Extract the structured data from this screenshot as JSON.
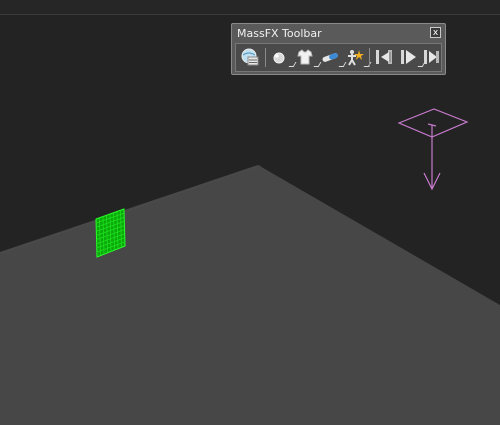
{
  "toolbar": {
    "title": "MassFX Toolbar",
    "close_glyph": "x",
    "buttons": [
      {
        "id": "world-params",
        "icon": "massfx-world-parameters-icon"
      },
      {
        "id": "rigid-body",
        "icon": "rigid-body-icon"
      },
      {
        "id": "mcloth",
        "icon": "mcloth-icon"
      },
      {
        "id": "constraint",
        "icon": "constraint-icon"
      },
      {
        "id": "ragdoll",
        "icon": "ragdoll-icon"
      },
      {
        "id": "reset-sim",
        "icon": "reset-simulation-icon"
      },
      {
        "id": "play-sim",
        "icon": "play-simulation-icon"
      },
      {
        "id": "step-sim",
        "icon": "step-simulation-icon"
      }
    ]
  },
  "colors": {
    "viewport_bg": "#232323",
    "ground": "#474747",
    "cloth": "#00c800",
    "gravity_gizmo": "#c77bcc"
  }
}
